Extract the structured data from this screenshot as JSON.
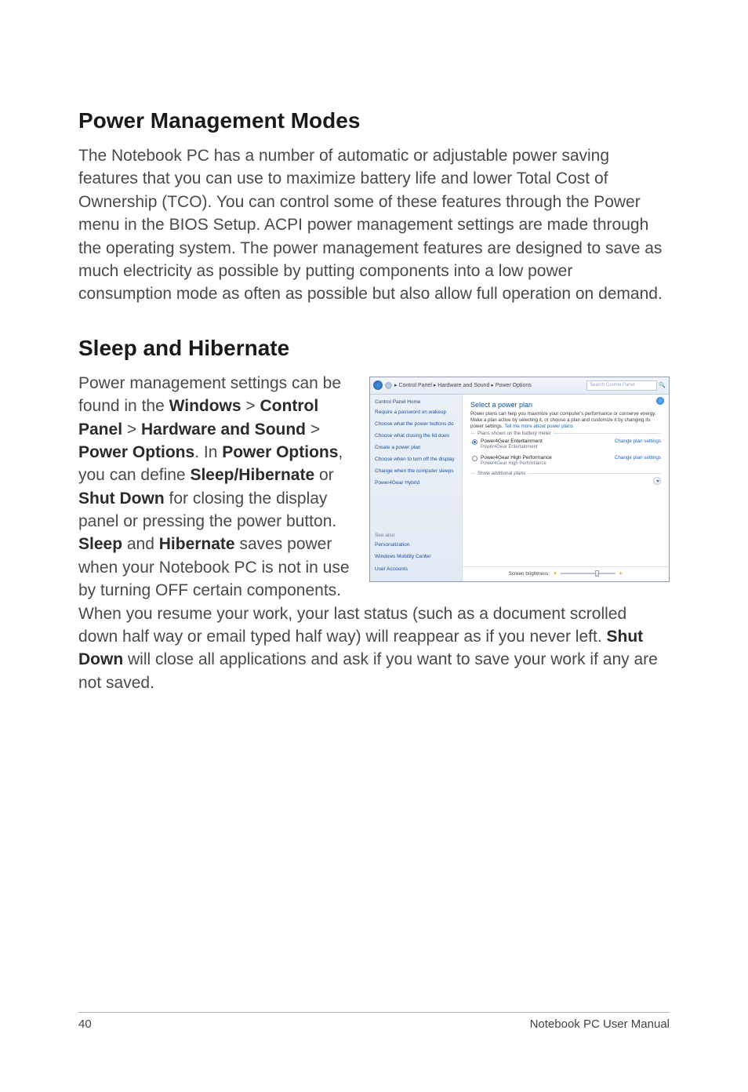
{
  "heading1": "Power Management Modes",
  "para1": "The Notebook PC has a number of automatic or adjustable power saving features that you can use to maximize battery life and lower Total Cost of Ownership (TCO). You can control some of these features through the Power menu in the BIOS Setup. ACPI power management settings are made through the operating system. The power management features are designed to save as much electricity as possible by putting components into a low power consumption mode as often as possible but also allow full operation on demand.",
  "heading2": "Sleep and Hibernate",
  "para2": {
    "t1": "Power management settings can be found in the ",
    "b1": "Windows",
    "t2": " > ",
    "b2": "Control Panel",
    "t3": " > ",
    "b3": "Hardware and Sound",
    "t4": " > ",
    "b4": "Power Options",
    "t5": ". In ",
    "b5": "Power Options",
    "t6": ", you can define ",
    "b6": "Sleep/Hibernate",
    "t7": " or ",
    "b7": "Shut Down",
    "t8": " for closing the display panel or pressing the power button. ",
    "b8": "Sleep",
    "t9": " and ",
    "b9": "Hibernate",
    "t10": " saves power when your Notebook PC is not in use by turning OFF certain components. When you resume your work, your last status (such as a document scrolled down half way or email typed half way) will reappear as if you never left. ",
    "b10": "Shut Down",
    "t11": " will close all applications and ask if you want to save your work if any are not saved."
  },
  "screenshot": {
    "breadcrumb": "▸ Control Panel ▸ Hardware and Sound ▸ Power Options",
    "searchPlaceholder": "Search Control Panel",
    "sidebar": {
      "home": "Control Panel Home",
      "items": [
        "Require a password on wakeup",
        "Choose what the power buttons do",
        "Choose what closing the lid does",
        "Create a power plan",
        "Choose when to turn off the display",
        "Change when the computer sleeps",
        "Power4Gear Hybrid"
      ],
      "seealso": "See also",
      "also": [
        "Personalization",
        "Windows Mobility Center",
        "User Accounts"
      ]
    },
    "main": {
      "title": "Select a power plan",
      "desc": "Power plans can help you maximize your computer's performance or conserve energy. Make a plan active by selecting it, or choose a plan and customize it by changing its power settings. ",
      "tellMore": "Tell me more about power plans",
      "groupLabel": "Plans shown on the battery meter",
      "plan1": {
        "name": "Power4Gear Entertainment",
        "sub": "Power4Gear Entertainment"
      },
      "plan2": {
        "name": "Power4Gear High Performance",
        "sub": "Power4Gear High Performance"
      },
      "change": "Change plan settings",
      "additional": "Show additional plans",
      "brightness": "Screen brightness:"
    }
  },
  "footer": {
    "pageNum": "40",
    "title": "Notebook PC User Manual"
  }
}
